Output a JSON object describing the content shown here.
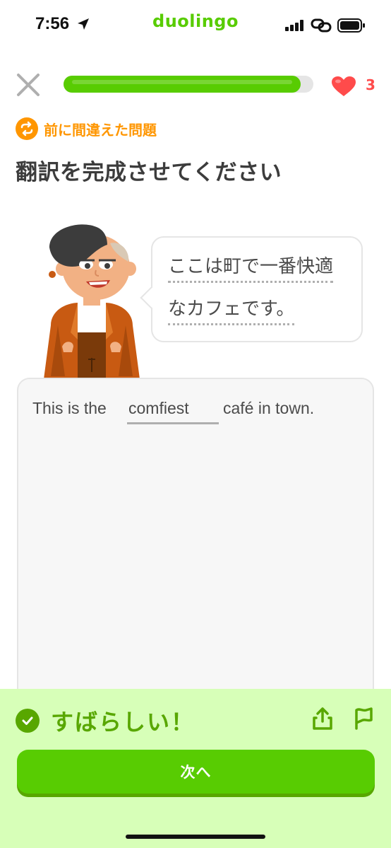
{
  "status_bar": {
    "time": "7:56",
    "app_brand": "duolingo",
    "icons": [
      "location-arrow-icon",
      "signal-icon",
      "link-icon",
      "battery-icon"
    ]
  },
  "lesson": {
    "progress": 0.95,
    "hearts": "3"
  },
  "prompt": {
    "review_label": "前に間違えた問題",
    "instruction": "翻訳を完成させてください"
  },
  "speech_bubble": {
    "line1": "ここは町で一番快適",
    "line2": "なカフェです。"
  },
  "exercise": {
    "before": "This is the",
    "answer": "comfiest",
    "after": "café in town."
  },
  "feedback": {
    "message": "すばらしい！",
    "next_label": "次へ"
  },
  "colors": {
    "green": "#58cc02",
    "dark_green": "#58a700",
    "orange": "#ff9600",
    "red": "#ff4b4b",
    "feedback_bg": "#d7ffb8"
  }
}
